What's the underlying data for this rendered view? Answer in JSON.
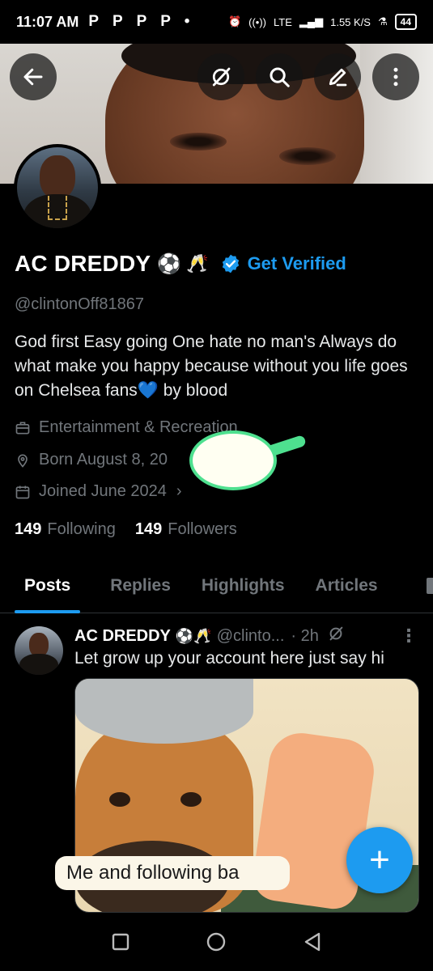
{
  "status_bar": {
    "time": "11:07 AM",
    "notif_icons": "P P P P •",
    "network": "LTE",
    "speed": "1.55 K/S",
    "battery": "44"
  },
  "header": {
    "back_icon": "arrow-left-icon",
    "grok_icon": "grok-icon",
    "search_icon": "search-icon",
    "edit_icon": "edit-icon",
    "more_icon": "more-vertical-icon"
  },
  "profile": {
    "display_name": "AC DREDDY",
    "name_emoji_1": "⚽",
    "name_emoji_2": "🥂",
    "get_verified_label": "Get Verified",
    "handle": "@clintonOff81867",
    "bio": "God first  Easy going One hate no man's Always do what make you happy because without you life goes on Chelsea fans💙 by blood",
    "category": "Entertainment & Recreation",
    "born": "Born August 8, 20",
    "joined": "Joined June 2024",
    "following_count": "149",
    "following_label": "Following",
    "followers_count": "149",
    "followers_label": "Followers"
  },
  "tabs": [
    "Posts",
    "Replies",
    "Highlights",
    "Articles"
  ],
  "active_tab": "Posts",
  "post": {
    "author": "AC DREDDY",
    "emoji": "⚽🥂",
    "handle": "@clinto...",
    "time": "· 2h",
    "text": "Let grow up your account here just say hi",
    "media_caption": "Me and following ba"
  },
  "fab_label": "+",
  "colors": {
    "accent": "#1d9bf0",
    "background": "#000000",
    "muted": "#71767b",
    "bubble_border": "#4ee08f"
  }
}
